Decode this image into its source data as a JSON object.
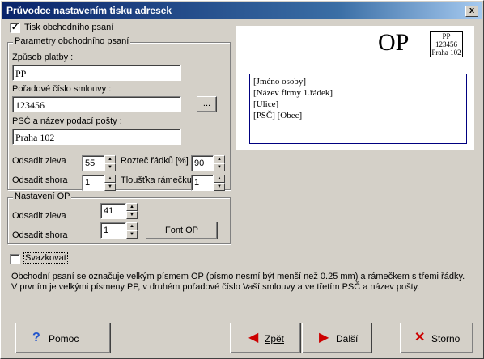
{
  "window": {
    "title": "Průvodce nastavením tisku adresek",
    "close_label": "x"
  },
  "print_business": {
    "label": "Tisk obchodního psaní",
    "checked": true
  },
  "params_group": {
    "caption": "Parametry obchodního psaní",
    "payment_label": "Způsob platby :",
    "payment_value": "PP",
    "contract_label": "Pořadové číslo smlouvy :",
    "contract_value": "123456",
    "browse_label": "...",
    "postal_label": "PSČ a název podací pošty :",
    "postal_value": "Praha 102",
    "offset_left_label": "Odsadit zleva",
    "offset_left_value": "55",
    "line_spacing_label": "Rozteč řádků [%]",
    "line_spacing_value": "90",
    "offset_top_label": "Odsadit shora",
    "offset_top_value": "1",
    "frame_label": "Tloušťka rámečku",
    "frame_value": "1"
  },
  "op_group": {
    "caption": "Nastavení OP",
    "offset_left_label": "Odsadit zleva",
    "offset_left_value": "41",
    "offset_top_label": "Odsadit shora",
    "offset_top_value": "1",
    "font_button": "Font OP"
  },
  "bundle": {
    "label": "Svazkovat",
    "checked": false
  },
  "description": "Obchodní psaní se označuje velkým písmem OP (písmo nesmí být menší než 0.25 mm) a rámečkem s třemi řádky. V prvním je velkými písmeny PP, v druhém pořadové číslo Vaší smlouvy a ve třetím PSČ a název pošty.",
  "preview": {
    "op_text": "OP",
    "stamp_lines": [
      "PP",
      "123456",
      "Praha 102"
    ],
    "address_lines": [
      "[Jméno osoby]",
      "[Název firmy 1.řádek]",
      "[Ulice]",
      "[PSČ]  [Obec]"
    ]
  },
  "buttons": {
    "help": "Pomoc",
    "back": "Zpět",
    "next": "Další",
    "cancel": "Storno"
  },
  "colors": {
    "title_bar": "#0a246a",
    "face": "#d4d0c8",
    "help_icon": "#2255cc",
    "arrow_icon": "#cc0000"
  }
}
